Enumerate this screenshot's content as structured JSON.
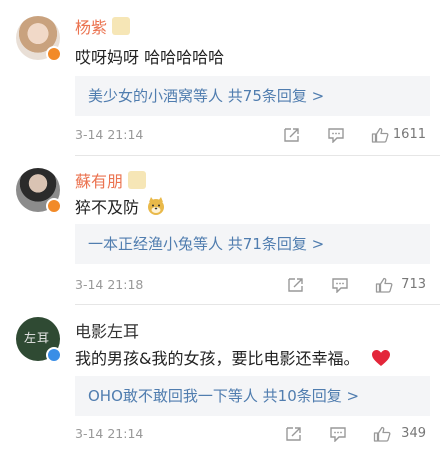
{
  "comments": [
    {
      "name": "杨紫",
      "text": "哎呀妈呀 哈哈哈哈哈",
      "reply": "美少女的小酒窝等人 共75条回复 >",
      "time": "3-14 21:14",
      "likes": "1611"
    },
    {
      "name": "蘇有朋",
      "text": "猝不及防",
      "reply": "一本正经渔小兔等人 共71条回复 >",
      "time": "3-14 21:18",
      "likes": "713"
    },
    {
      "name": "电影左耳",
      "text": "我的男孩&我的女孩，要比电影还幸福。",
      "reply": "OHO敢不敢回我一下等人 共10条回复 >",
      "time": "3-14 21:14",
      "likes": "349",
      "avatar_text": "左耳"
    }
  ],
  "colors": {
    "name_orange": "#eb7350",
    "link_blue": "#507daf",
    "reply_bg": "#f4f5f7",
    "heart": "#e3263a"
  }
}
